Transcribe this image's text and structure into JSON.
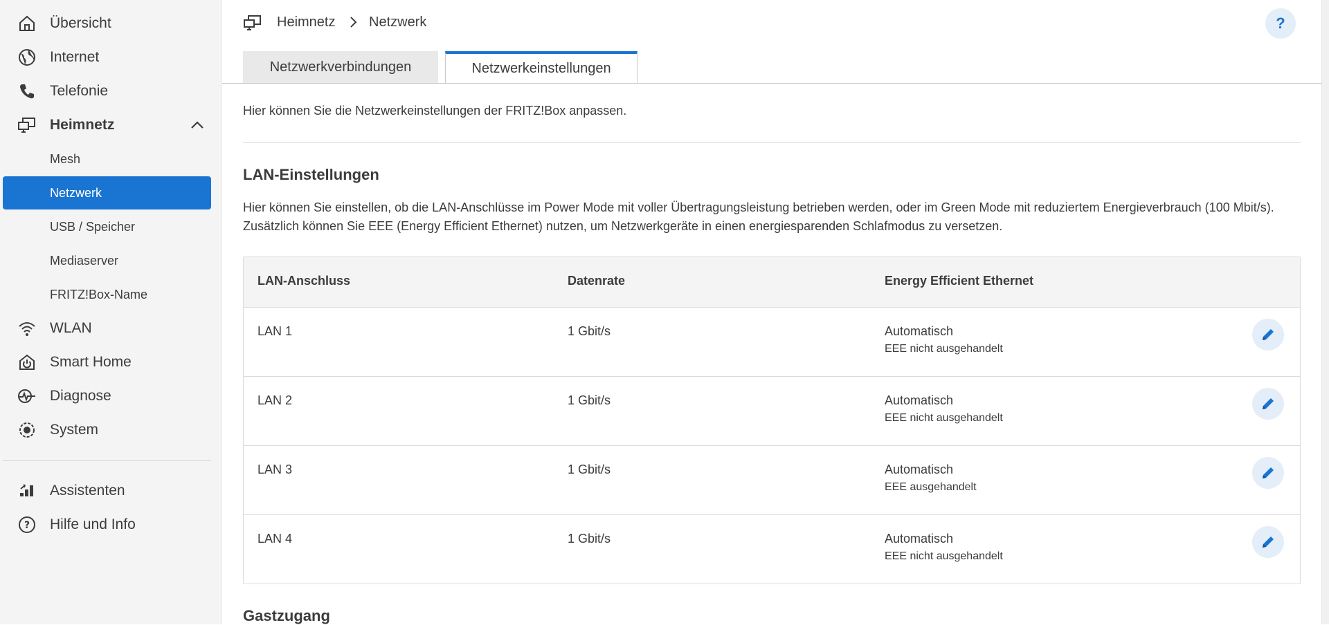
{
  "sidebar": {
    "items": [
      {
        "label": "Übersicht",
        "icon": "home-icon"
      },
      {
        "label": "Internet",
        "icon": "globe-icon"
      },
      {
        "label": "Telefonie",
        "icon": "phone-icon"
      },
      {
        "label": "Heimnetz",
        "icon": "network-icon",
        "expanded": true
      },
      {
        "label": "WLAN",
        "icon": "wifi-icon"
      },
      {
        "label": "Smart Home",
        "icon": "smart-home-icon"
      },
      {
        "label": "Diagnose",
        "icon": "diagnose-icon"
      },
      {
        "label": "System",
        "icon": "system-icon"
      }
    ],
    "subitems": [
      {
        "label": "Mesh"
      },
      {
        "label": "Netzwerk",
        "active": true
      },
      {
        "label": "USB / Speicher"
      },
      {
        "label": "Mediaserver"
      },
      {
        "label": "FRITZ!Box-Name"
      }
    ],
    "bottom": [
      {
        "label": "Assistenten",
        "icon": "assistant-icon"
      },
      {
        "label": "Hilfe und Info",
        "icon": "help-circle-icon"
      }
    ]
  },
  "header": {
    "breadcrumb": [
      "Heimnetz",
      "Netzwerk"
    ],
    "help_label": "?"
  },
  "tabs": [
    {
      "label": "Netzwerkverbindungen",
      "active": false
    },
    {
      "label": "Netzwerkeinstellungen",
      "active": true
    }
  ],
  "main": {
    "intro": "Hier können Sie die Netzwerkeinstellungen der FRITZ!Box anpassen.",
    "lan_title": "LAN-Einstellungen",
    "lan_description": "Hier können Sie einstellen, ob die LAN-Anschlüsse im Power Mode mit voller Übertragungsleistung betrieben werden, oder im Green Mode mit reduziertem Energieverbrauch (100 Mbit/s). Zusätzlich können Sie EEE (Energy Efficient Ethernet) nutzen, um Netzwerkgeräte in einen energiesparenden Schlafmodus zu versetzen.",
    "guest_title": "Gastzugang"
  },
  "table": {
    "headers": [
      "LAN-Anschluss",
      "Datenrate",
      "Energy Efficient Ethernet"
    ],
    "rows": [
      {
        "port": "LAN 1",
        "rate": "1 Gbit/s",
        "eee": "Automatisch",
        "eee_status": "EEE nicht ausgehandelt"
      },
      {
        "port": "LAN 2",
        "rate": "1 Gbit/s",
        "eee": "Automatisch",
        "eee_status": "EEE nicht ausgehandelt"
      },
      {
        "port": "LAN 3",
        "rate": "1 Gbit/s",
        "eee": "Automatisch",
        "eee_status": "EEE ausgehandelt"
      },
      {
        "port": "LAN 4",
        "rate": "1 Gbit/s",
        "eee": "Automatisch",
        "eee_status": "EEE nicht ausgehandelt"
      }
    ]
  },
  "colors": {
    "accent": "#1a74d1",
    "sidebar_bg": "#f4f4f4",
    "text": "#3c3c3c"
  }
}
